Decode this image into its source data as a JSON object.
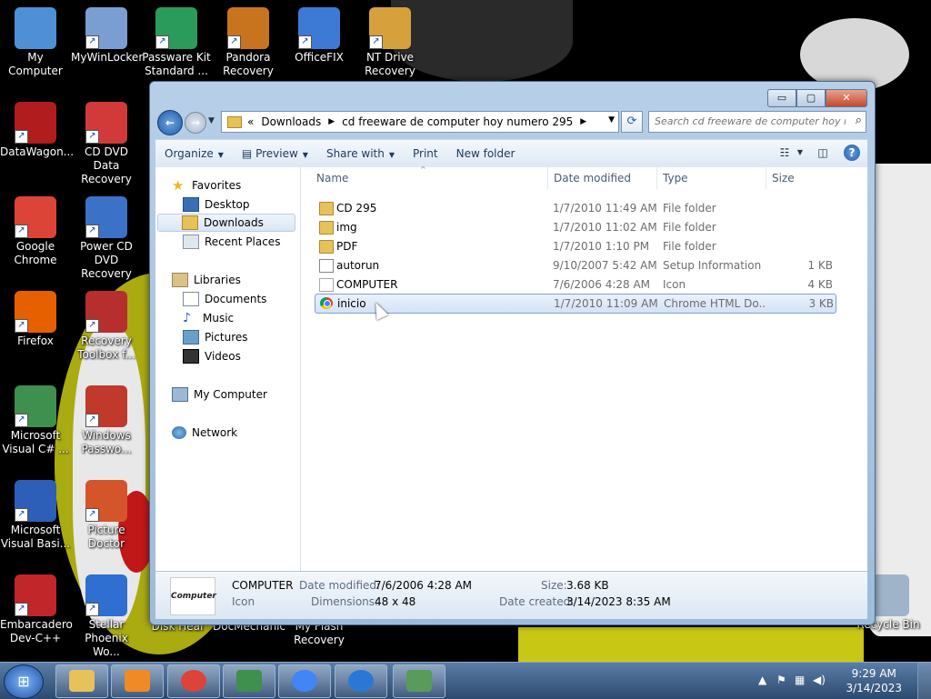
{
  "desktop_icons": [
    {
      "label": "My Computer",
      "color": "#4f8fd6"
    },
    {
      "label": "MyWinLocker",
      "color": "#7a9ed1"
    },
    {
      "label": "Passware Kit Standard ...",
      "color": "#2a9b5b"
    },
    {
      "label": "Pandora Recovery",
      "color": "#c8741e"
    },
    {
      "label": "OfficeFIX",
      "color": "#3d7ad6"
    },
    {
      "label": "NT Drive Recovery",
      "color": "#d6a03d"
    },
    {
      "label": "DataWagon...",
      "color": "#b11c1c"
    },
    {
      "label": "CD DVD Data Recovery",
      "color": "#d23a3a"
    },
    {
      "label": "Google Chrome",
      "color": "#db4437"
    },
    {
      "label": "Power CD DVD Recovery",
      "color": "#3b72c7"
    },
    {
      "label": "Firefox",
      "color": "#e66000"
    },
    {
      "label": "Recovery Toolbox f...",
      "color": "#b62e2e"
    },
    {
      "label": "Microsoft Visual C# ...",
      "color": "#3f8f4f"
    },
    {
      "label": "Windows Passwo...",
      "color": "#c0392b"
    },
    {
      "label": "Microsoft Visual Basi...",
      "color": "#2e5fb8"
    },
    {
      "label": "Picture Doctor",
      "color": "#d4552a"
    },
    {
      "label": "Embarcadero Dev-C++",
      "color": "#c0262a"
    },
    {
      "label": "Stellar Phoenix Wo...",
      "color": "#2e6fd1"
    },
    {
      "label": "Disk Heal",
      "color": "#444"
    },
    {
      "label": "DocMechanic",
      "color": "#444"
    },
    {
      "label": "My Flash Recovery",
      "color": "#444"
    },
    {
      "label": "Recycle Bin",
      "color": "#9fb4c8"
    }
  ],
  "window": {
    "controls": {
      "minimize": "▭",
      "maximize": "▢",
      "close": "✕"
    },
    "address": {
      "prefix": "«",
      "crumbs": [
        "Downloads",
        "cd freeware de computer hoy numero 295"
      ]
    },
    "search_placeholder": "Search cd freeware de computer hoy n..."
  },
  "toolbar": {
    "organize": "Organize",
    "preview": "Preview",
    "share_with": "Share with",
    "print": "Print",
    "new_folder": "New folder"
  },
  "nav": {
    "favorites": "Favorites",
    "desktop": "Desktop",
    "downloads": "Downloads",
    "recent_places": "Recent Places",
    "libraries": "Libraries",
    "documents": "Documents",
    "music": "Music",
    "pictures": "Pictures",
    "videos": "Videos",
    "my_computer": "My Computer",
    "network": "Network"
  },
  "columns": {
    "name": "Name",
    "date_modified": "Date modified",
    "type": "Type",
    "size": "Size"
  },
  "files": [
    {
      "name": "CD 295",
      "modified": "1/7/2010 11:49 AM",
      "type": "File folder",
      "size": "",
      "icon": "folder-icon"
    },
    {
      "name": "img",
      "modified": "1/7/2010 11:02 AM",
      "type": "File folder",
      "size": "",
      "icon": "folder-icon"
    },
    {
      "name": "PDF",
      "modified": "1/7/2010 1:10 PM",
      "type": "File folder",
      "size": "",
      "icon": "folder-icon"
    },
    {
      "name": "autorun",
      "modified": "9/10/2007 5:42 AM",
      "type": "Setup Information",
      "size": "1 KB",
      "icon": "setup-info-icon"
    },
    {
      "name": "COMPUTER",
      "modified": "7/6/2006 4:28 AM",
      "type": "Icon",
      "size": "4 KB",
      "icon": "icon-file-icon"
    },
    {
      "name": "inicio",
      "modified": "1/7/2010 11:09 AM",
      "type": "Chrome HTML Do...",
      "size": "3 KB",
      "icon": "chrome-icon"
    }
  ],
  "details": {
    "thumb_text": "Computer",
    "name": "COMPUTER",
    "kind": "Icon",
    "date_modified_label": "Date modified:",
    "date_modified": "7/6/2006 4:28 AM",
    "dimensions_label": "Dimensions:",
    "dimensions": "48 x 48",
    "size_label": "Size:",
    "size": "3.68 KB",
    "date_created_label": "Date created:",
    "date_created": "3/14/2023 8:35 AM"
  },
  "taskbar": {
    "start_glyph": "⊞",
    "buttons": [
      {
        "name": "explorer",
        "color": "#e7c15a"
      },
      {
        "name": "media-player",
        "color": "#f08a24"
      },
      {
        "name": "chrome",
        "color": "#db4437"
      },
      {
        "name": "visual-csharp",
        "color": "#3f8f4f"
      },
      {
        "name": "chromium",
        "color": "#4285f4"
      },
      {
        "name": "internet-explorer",
        "color": "#2a78d6"
      },
      {
        "name": "system-utility",
        "color": "#5a9a5a"
      }
    ],
    "time": "9:29 AM",
    "date": "3/14/2023"
  }
}
